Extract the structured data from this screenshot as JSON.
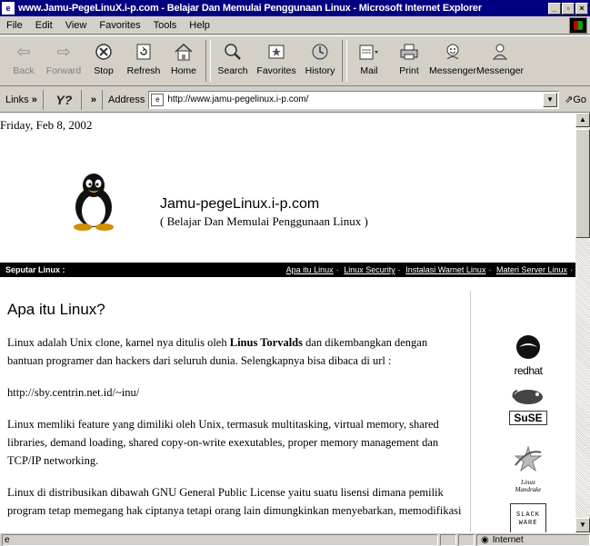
{
  "window": {
    "title": "www.Jamu-PegeLinuX.i-p.com - Belajar Dan Memulai Penggunaan Linux - Microsoft Internet Explorer"
  },
  "menu": [
    "File",
    "Edit",
    "View",
    "Favorites",
    "Tools",
    "Help"
  ],
  "toolbar": {
    "back": "Back",
    "forward": "Forward",
    "stop": "Stop",
    "refresh": "Refresh",
    "home": "Home",
    "search": "Search",
    "favorites": "Favorites",
    "history": "History",
    "mail": "Mail",
    "print": "Print",
    "messenger1": "Messenger",
    "messenger2": "Messenger"
  },
  "address": {
    "links_label": "Links",
    "links_chevron": "»",
    "yahoo_chevron": "»",
    "label": "Address",
    "url": "http://www.jamu-pegelinux.i-p.com/",
    "go": "Go"
  },
  "page": {
    "date": "Friday, Feb 8, 2002",
    "site_name": "Jamu-pegeLinux.i-p.com",
    "tagline": "( Belajar Dan Memulai Penggunaan Linux )",
    "nav_label": "Seputar Linux :",
    "nav_links": [
      "Apa itu Linux",
      "Linux Security",
      "Instalasi Warnet Linux",
      "Materi Server Linux"
    ],
    "article": {
      "heading": "Apa itu Linux?",
      "p1_before": "Linux adalah Unix clone, karnel nya ditulis oleh ",
      "p1_bold": "Linus Torvalds",
      "p1_after": " dan dikembangkan dengan bantuan programer dan hackers dari seluruh dunia. Selengkapnya bisa dibaca di url :",
      "p2": "http://sby.centrin.net.id/~inu/",
      "p3": "Linux memliki feature yang dimiliki oleh Unix, termasuk multitasking, virtual memory, shared libraries, demand loading, shared copy-on-write exexutables, proper memory management dan TCP/IP networking.",
      "p4": "Linux di distribusikan dibawah GNU General Public License yaitu suatu lisensi dimana pemilik program tetap memegang hak ciptanya tetapi orang lain dimungkinkan menyebarkan, memodifikasi"
    },
    "logos": {
      "redhat": "redhat",
      "suse": "SuSE",
      "mandrake_top": "Linux",
      "mandrake_bottom": "Mandrake",
      "slackware_1": "SLACK",
      "slackware_2": "WARE"
    }
  },
  "status": {
    "zone": "Internet"
  }
}
